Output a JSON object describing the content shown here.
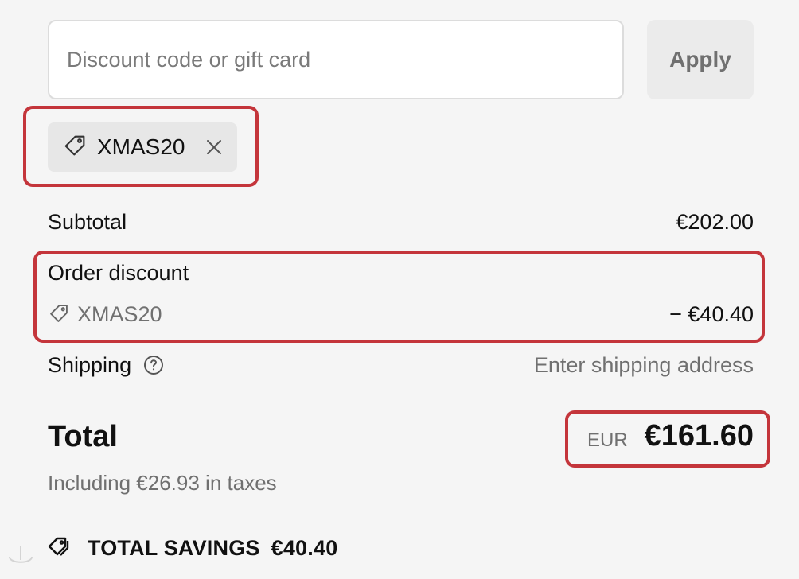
{
  "discount_form": {
    "placeholder": "Discount code or gift card",
    "value": "",
    "apply_label": "Apply"
  },
  "applied_code": {
    "code": "XMAS20",
    "icon": "tag-icon",
    "remove_icon": "close-icon"
  },
  "summary": {
    "subtotal_label": "Subtotal",
    "subtotal_value": "€202.00",
    "order_discount_label": "Order discount",
    "order_discount_code": "XMAS20",
    "order_discount_value": "− €40.40",
    "shipping_label": "Shipping",
    "shipping_value": "Enter shipping address",
    "shipping_help_icon": "question-circle-icon"
  },
  "total": {
    "label": "Total",
    "currency": "EUR",
    "value": "€161.60",
    "taxes_note": "Including €26.93 in taxes"
  },
  "savings": {
    "icon": "tags-icon",
    "label": "TOTAL SAVINGS",
    "amount": "€40.40"
  },
  "colors": {
    "highlight": "#c4353b",
    "background": "#f5f5f5",
    "muted_text": "#707070"
  }
}
